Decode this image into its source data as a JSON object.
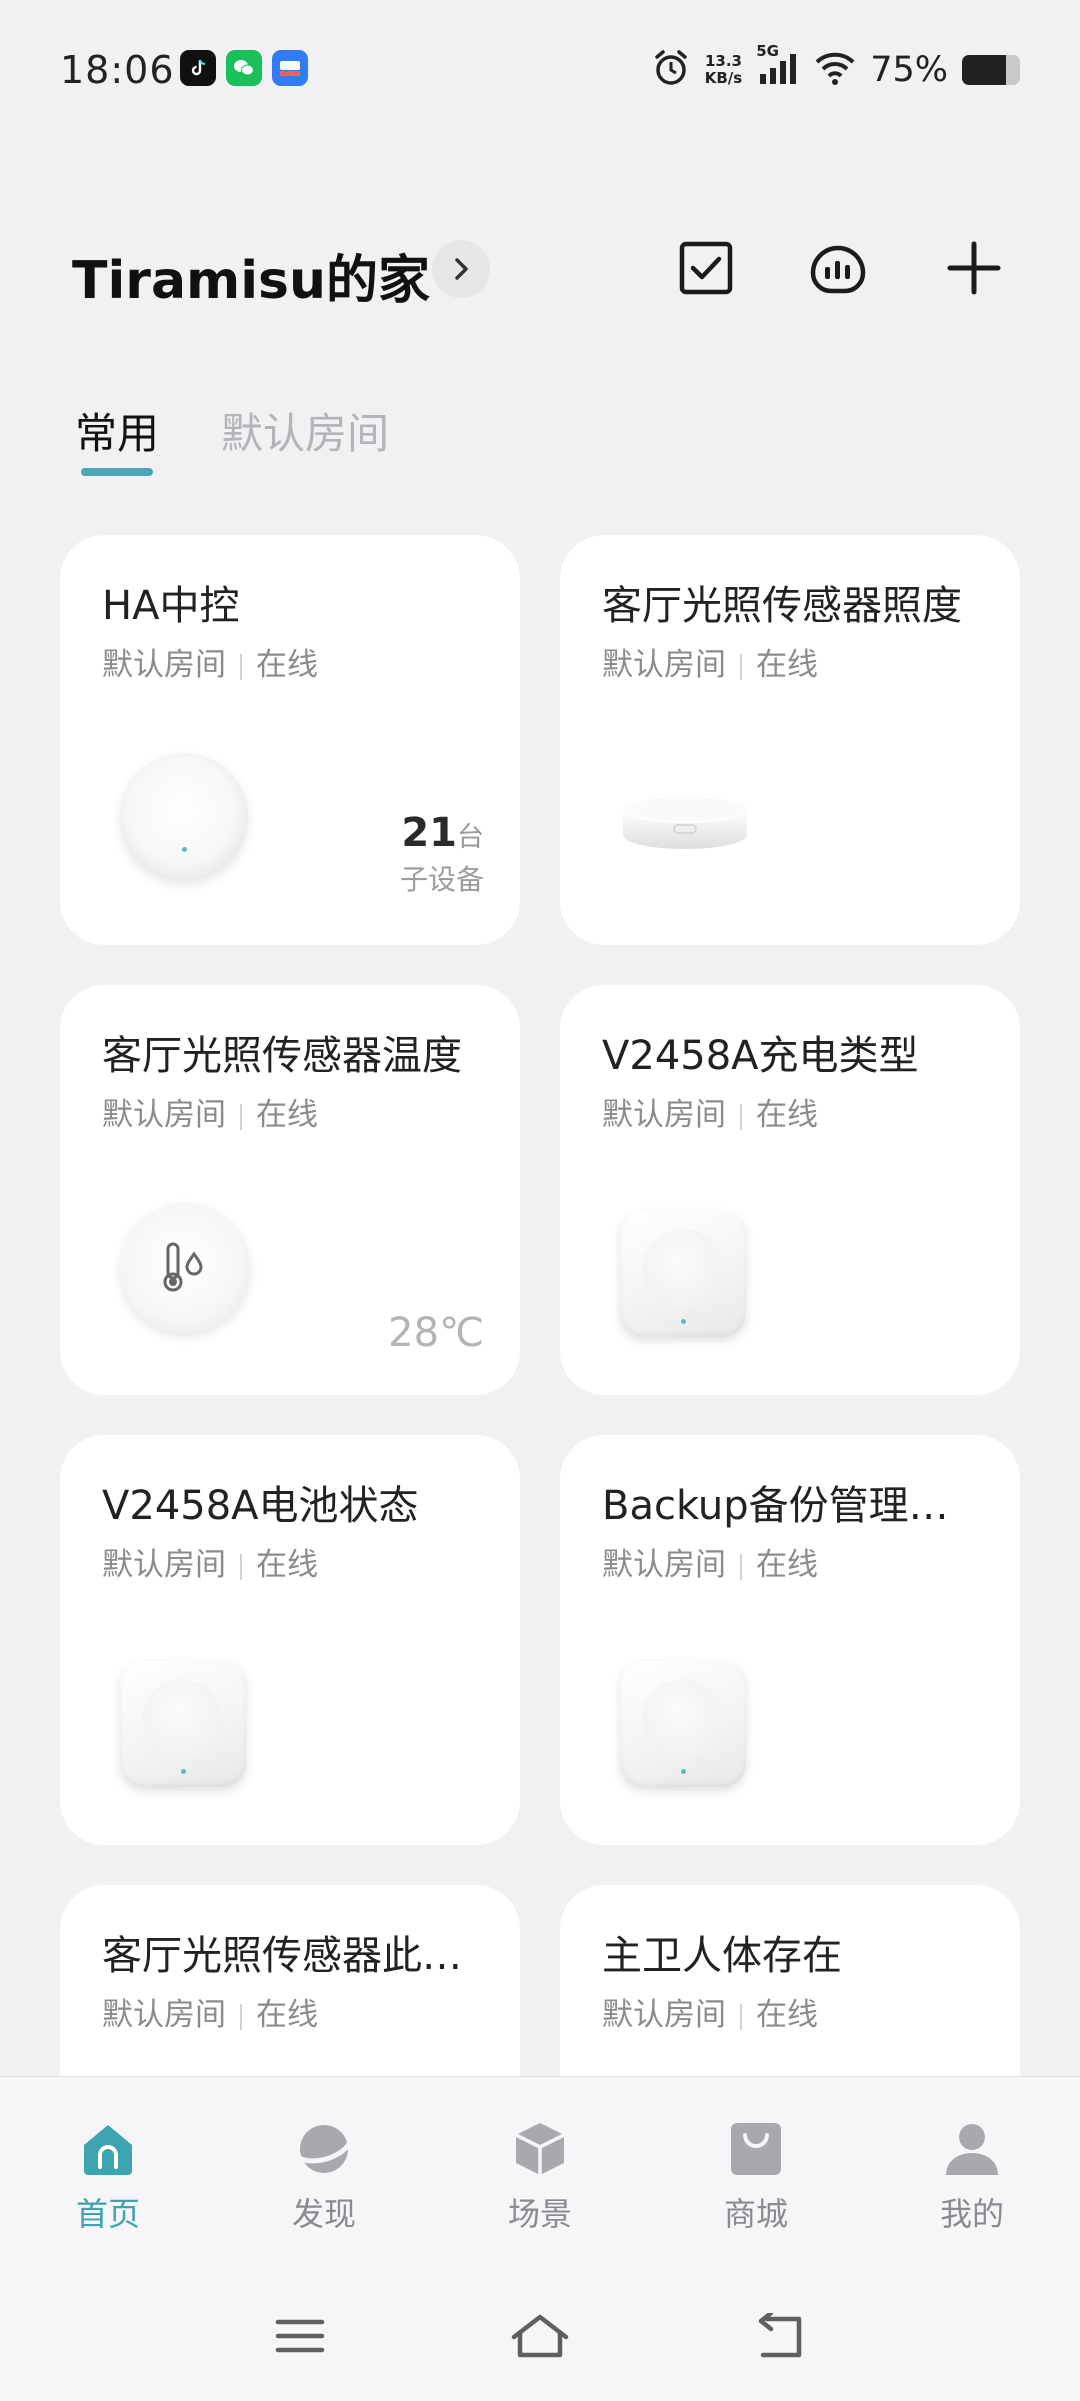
{
  "status_bar": {
    "time": "18:06",
    "net_speed_value": "13.3",
    "net_speed_unit": "KB/s",
    "network": "5G",
    "battery_text": "75%",
    "battery_level": 0.75,
    "app_icons": [
      "tiktok-icon",
      "wechat-icon",
      "hala-icon"
    ]
  },
  "header": {
    "home_name": "Tiramisu的家",
    "actions": [
      "checklist-icon",
      "energy-meter-icon",
      "add-icon"
    ]
  },
  "tabs": [
    {
      "label": "常用",
      "active": true
    },
    {
      "label": "默认房间",
      "active": false
    }
  ],
  "devices": [
    {
      "name": "HA中控",
      "room": "默认房间",
      "status": "在线",
      "count": "21",
      "count_unit": "台",
      "count_label": "子设备",
      "image": "hub"
    },
    {
      "name": "客厅光照传感器照度",
      "room": "默认房间",
      "status": "在线",
      "image": "light-sensor"
    },
    {
      "name": "客厅光照传感器温度",
      "room": "默认房间",
      "status": "在线",
      "value": "28℃",
      "image": "temp-sensor"
    },
    {
      "name": "V2458A充电类型",
      "room": "默认房间",
      "status": "在线",
      "image": "switch"
    },
    {
      "name": "V2458A电池状态",
      "room": "默认房间",
      "status": "在线",
      "image": "switch"
    },
    {
      "name": "Backup备份管理…",
      "room": "默认房间",
      "status": "在线",
      "image": "switch"
    },
    {
      "name": "客厅光照传感器此…",
      "room": "默认房间",
      "status": "在线"
    },
    {
      "name": "主卫人体存在",
      "room": "默认房间",
      "status": "在线"
    }
  ],
  "bottom_nav": [
    {
      "label": "首页",
      "icon": "home-icon",
      "active": true
    },
    {
      "label": "发现",
      "icon": "discover-icon",
      "active": false
    },
    {
      "label": "场景",
      "icon": "scene-cube-icon",
      "active": false
    },
    {
      "label": "商城",
      "icon": "shop-bag-icon",
      "active": false
    },
    {
      "label": "我的",
      "icon": "profile-icon",
      "active": false
    }
  ],
  "colors": {
    "accent": "#3da3b0",
    "background": "#f1f1f3",
    "card": "#ffffff",
    "inactive_text": "#8b8b8f"
  }
}
